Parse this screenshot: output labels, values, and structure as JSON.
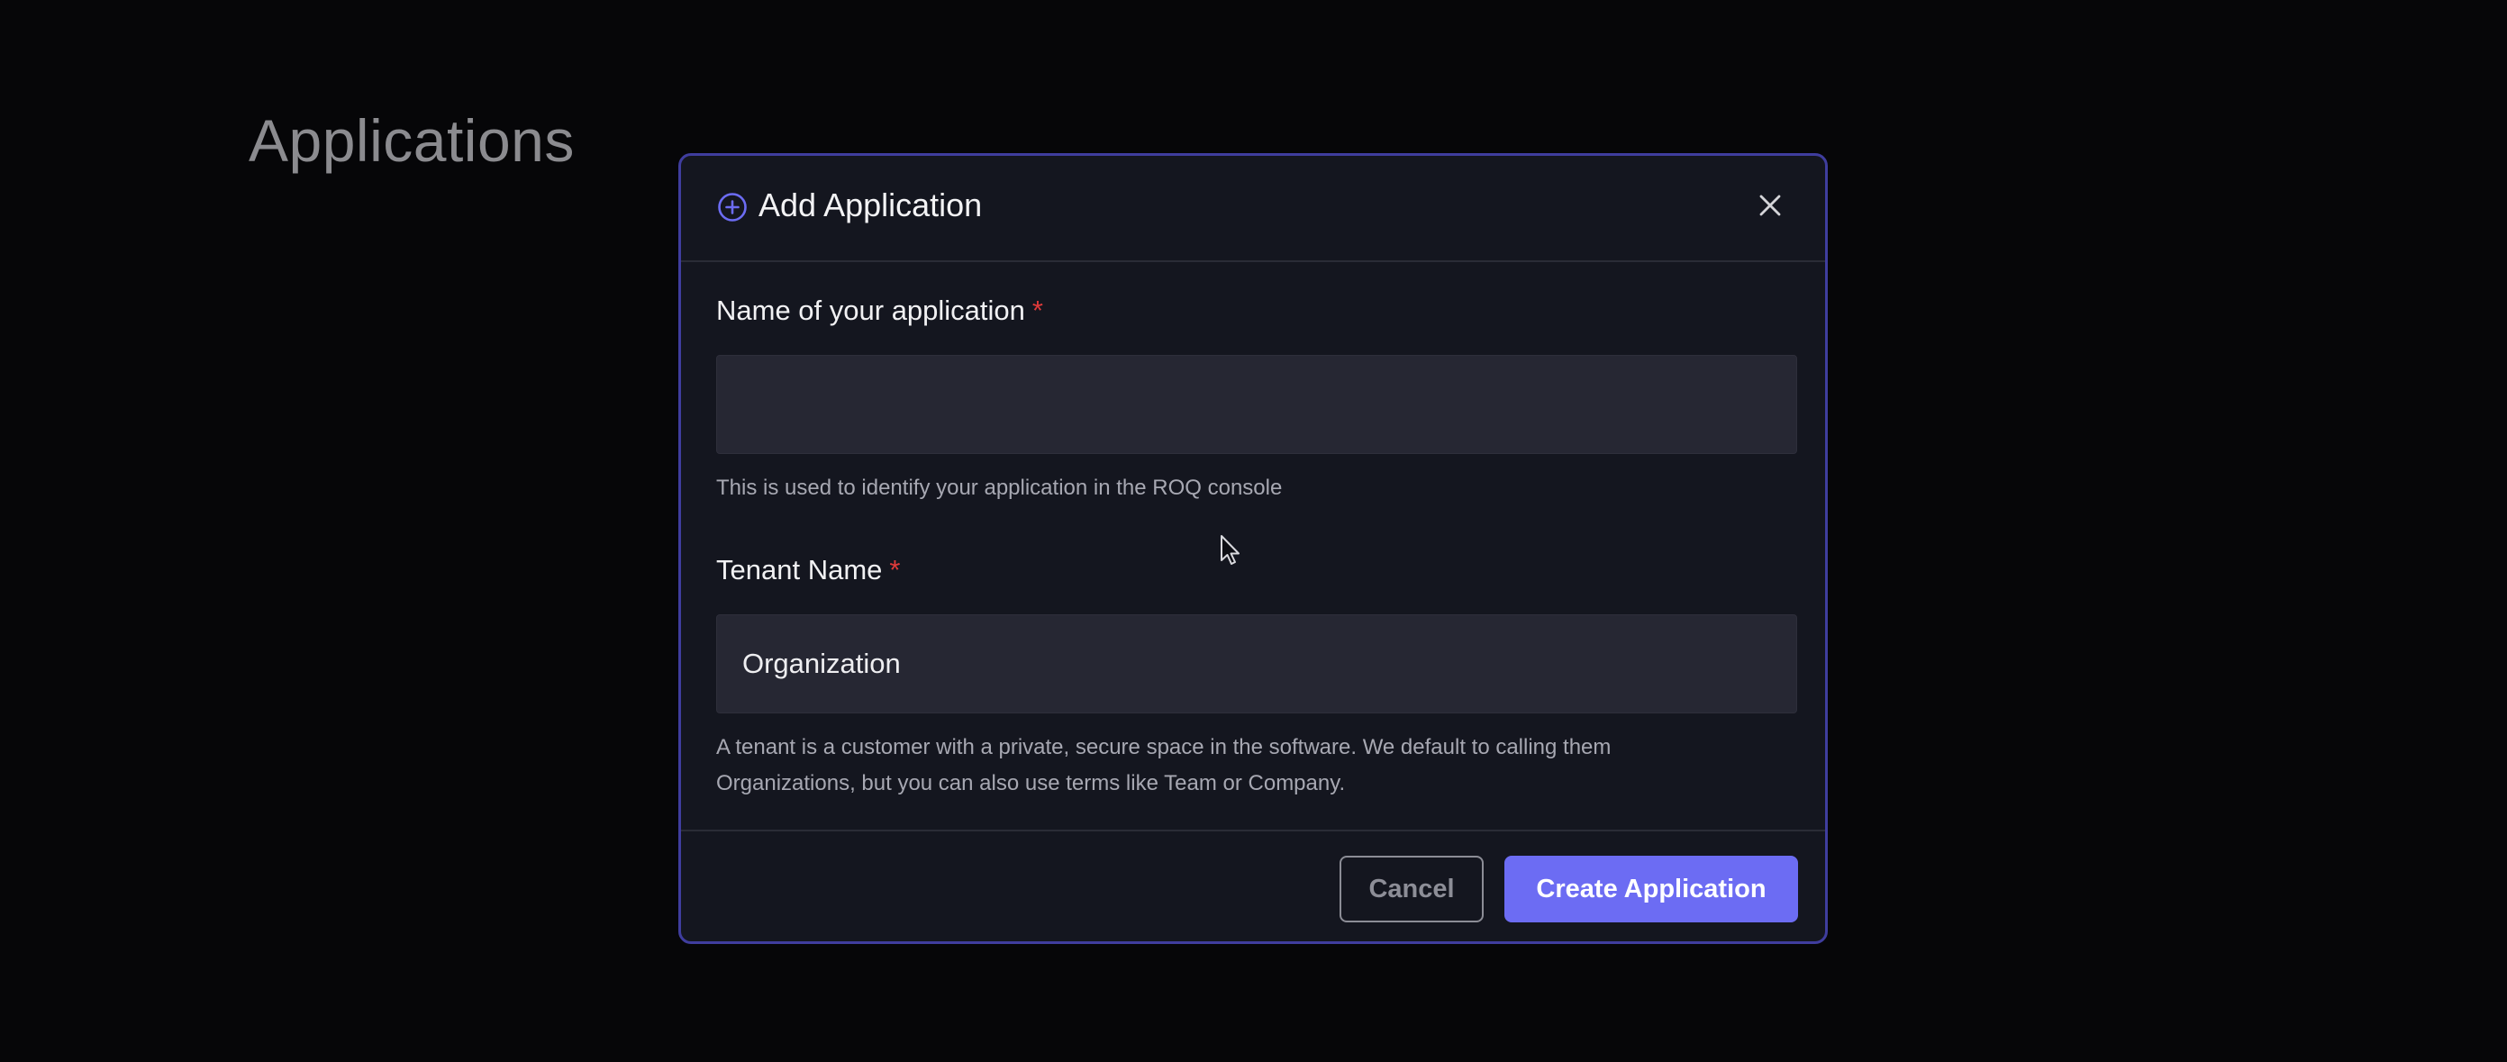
{
  "background": {
    "title": "Applications"
  },
  "modal": {
    "title": "Add Application",
    "header_icon": "plus-circle-icon",
    "close_icon": "close-icon",
    "accent_color": "#6c6cf3",
    "fields": {
      "app_name": {
        "label": "Name of your application",
        "required_mark": "*",
        "value": "",
        "placeholder": "",
        "help": "This is used to identify your application in the ROQ console"
      },
      "tenant_name": {
        "label": "Tenant Name",
        "required_mark": "*",
        "value": "Organization",
        "help": "A tenant is a customer with a private, secure space in the software. We default to calling them Organizations, but you can also use terms like Team or Company."
      }
    },
    "buttons": {
      "cancel": "Cancel",
      "create": "Create Application"
    }
  },
  "cursor_icon": "mouse-pointer-icon"
}
